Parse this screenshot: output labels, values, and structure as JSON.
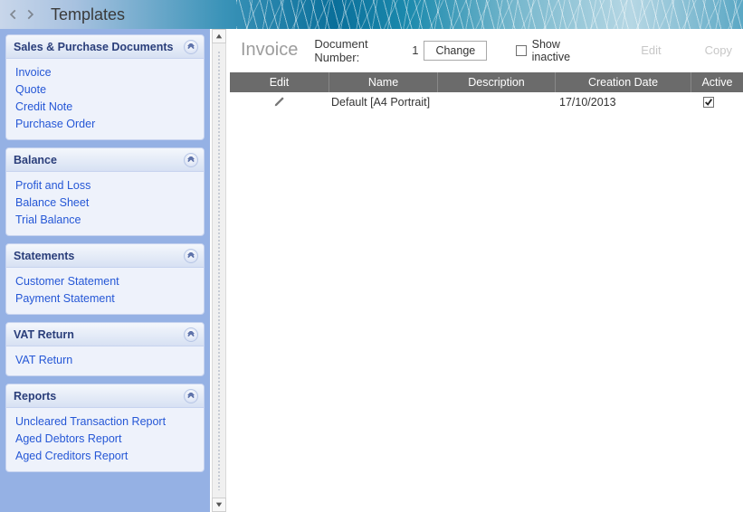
{
  "header": {
    "title": "Templates"
  },
  "sidebar": {
    "panels": [
      {
        "title": "Sales & Purchase Documents",
        "items": [
          "Invoice",
          "Quote",
          "Credit Note",
          "Purchase Order"
        ]
      },
      {
        "title": "Balance",
        "items": [
          "Profit and Loss",
          "Balance Sheet",
          "Trial Balance"
        ]
      },
      {
        "title": "Statements",
        "items": [
          "Customer Statement",
          "Payment Statement"
        ]
      },
      {
        "title": "VAT Return",
        "items": [
          "VAT Return"
        ]
      },
      {
        "title": "Reports",
        "items": [
          "Uncleared Transaction Report",
          "Aged Debtors Report",
          "Aged Creditors Report"
        ]
      }
    ]
  },
  "main": {
    "title": "Invoice",
    "doc_number_label": "Document Number:",
    "doc_number_value": "1",
    "change_label": "Change",
    "show_inactive_label": "Show inactive",
    "edit_label": "Edit",
    "copy_label": "Copy",
    "columns": {
      "edit": "Edit",
      "name": "Name",
      "description": "Description",
      "creation": "Creation Date",
      "active": "Active"
    },
    "rows": [
      {
        "name": "Default [A4 Portrait]",
        "description": "",
        "creation": "17/10/2013",
        "active": true
      }
    ]
  }
}
